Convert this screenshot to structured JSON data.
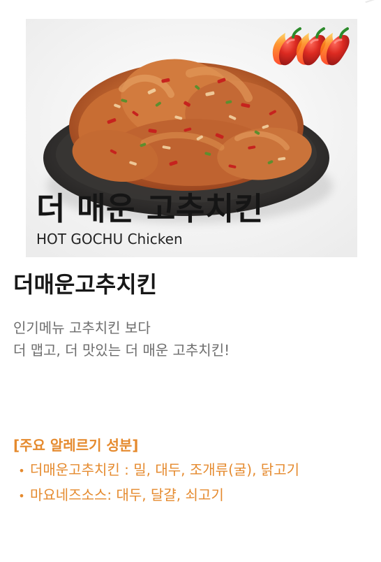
{
  "photo": {
    "title_ko": "더 매운 고추치킨",
    "title_en": "HOT GOCHU Chicken",
    "spice_level": 3,
    "spice_icon": "chili-pepper-icon"
  },
  "menu": {
    "name": "더매운고추치킨",
    "description": [
      "인기메뉴 고추치킨 보다",
      "더 맵고, 더 맛있는 더 매운 고추치킨!"
    ]
  },
  "allergy": {
    "title": "[주요 알레르기 성분]",
    "bullet": "•",
    "items": [
      {
        "text": "더매운고추치킨 : 밀, 대두, 조개류(굴), 닭고기"
      },
      {
        "text": "마요네즈소스: 대두, 달걀, 쇠고기"
      }
    ]
  },
  "colors": {
    "accent": "#e58a2e",
    "title_text": "#171717",
    "body_text": "#6d6d6d",
    "pepper_red": "#d7261f"
  }
}
